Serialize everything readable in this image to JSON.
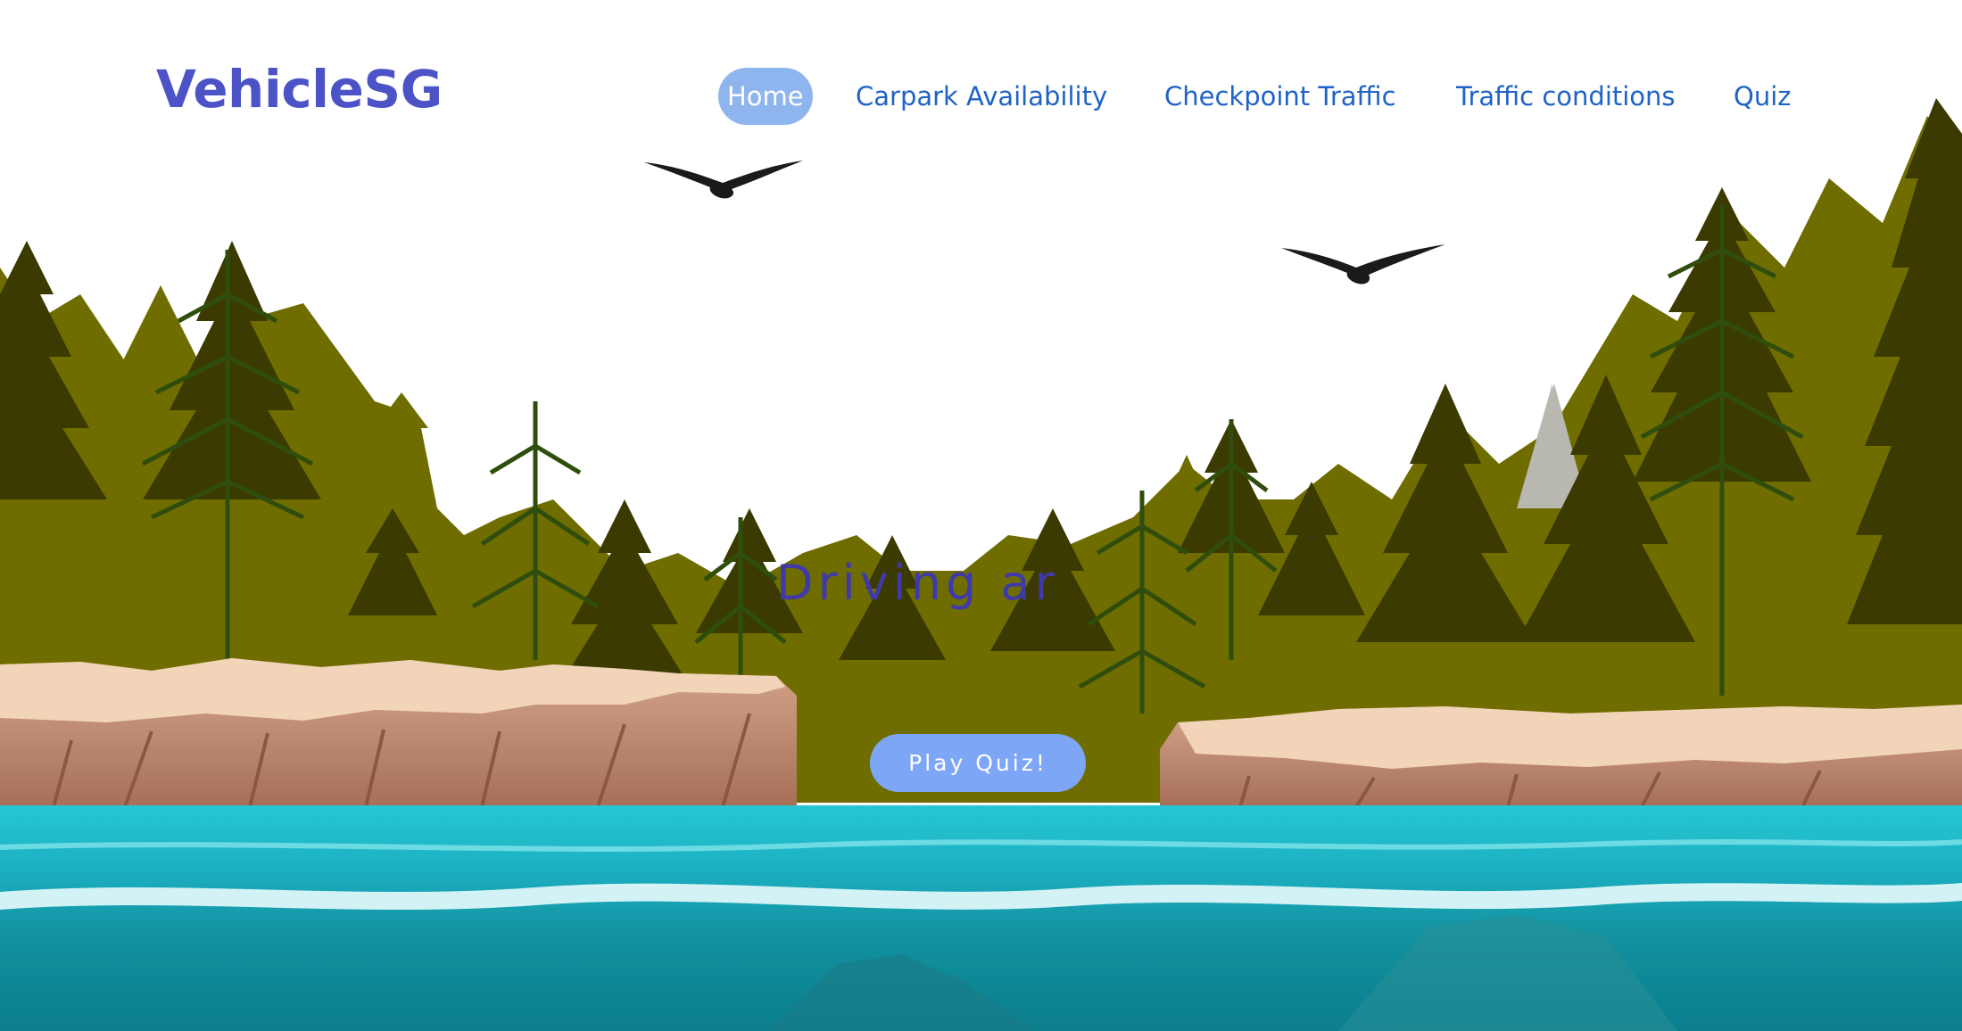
{
  "brand": {
    "name": "VehicleSG"
  },
  "nav": {
    "items": [
      {
        "label": "Home",
        "active": true
      },
      {
        "label": "Carpark Availability",
        "active": false
      },
      {
        "label": "Checkpoint Traffic",
        "active": false
      },
      {
        "label": "Traffic conditions",
        "active": false
      },
      {
        "label": "Quiz",
        "active": false
      }
    ]
  },
  "hero": {
    "headline_visible": "Driving ar",
    "cta_label": "Play Quiz!"
  },
  "colors": {
    "brand": "#4b53c7",
    "nav_link": "#1f63c6",
    "nav_active_bg": "#8fb5ef",
    "cta_bg": "#7ea6f6",
    "headline": "#3f3aa8",
    "pine_dark": "#3b3a00",
    "pine_olive": "#6f6d00",
    "cliff": "#c79980",
    "cliff_top": "#f1d2b6",
    "water": "#1aa6b5"
  },
  "scene": {
    "illustration": "forest-lake-landscape",
    "decorations": [
      "bird-icon",
      "bird-icon"
    ]
  }
}
